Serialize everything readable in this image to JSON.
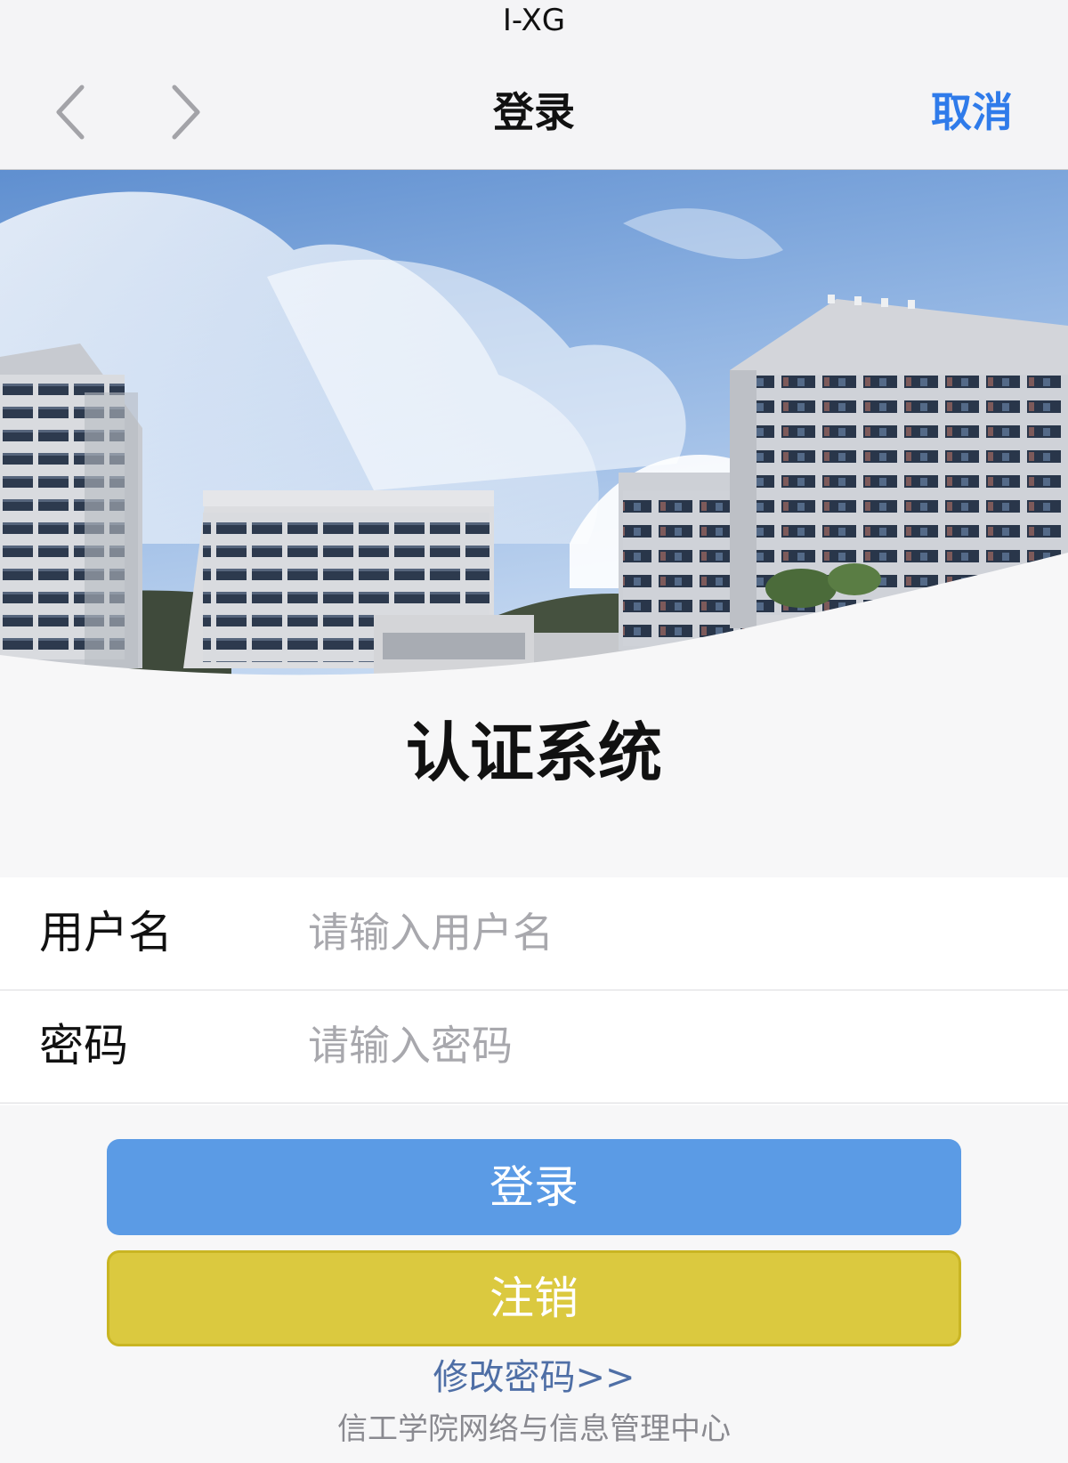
{
  "browser": {
    "url_title": "I-XG",
    "back_icon": "chevron-left-icon",
    "forward_icon": "chevron-right-icon",
    "page_title": "登录",
    "cancel_label": "取消"
  },
  "colors": {
    "accent_blue": "#2f7bea",
    "login_button": "#5b9be5",
    "logout_button": "#dbc93f",
    "link": "#4f6fa6"
  },
  "hero": {
    "image": "campus-buildings-sky-photo"
  },
  "system": {
    "title": "认证系统"
  },
  "form": {
    "username": {
      "label": "用户名",
      "placeholder": "请输入用户名",
      "value": ""
    },
    "password": {
      "label": "密码",
      "placeholder": "请输入密码",
      "value": ""
    }
  },
  "actions": {
    "login_label": "登录",
    "logout_label": "注销",
    "change_password_label": "修改密码>>"
  },
  "footer": {
    "text": "信工学院网络与信息管理中心"
  }
}
